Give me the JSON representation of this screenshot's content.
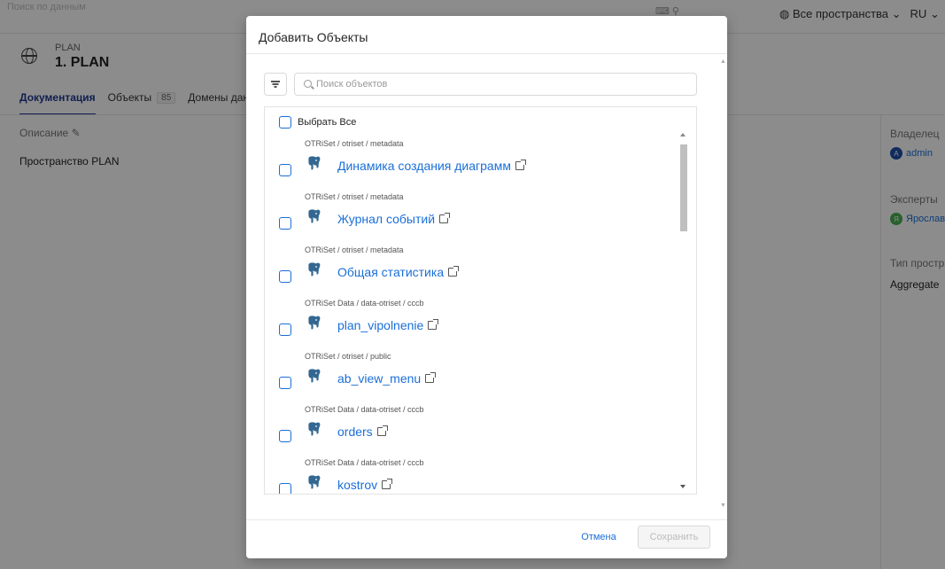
{
  "topbar": {
    "search_placeholder": "Поиск по данным",
    "spaces_label": "Все пространства",
    "lang": "RU"
  },
  "space": {
    "code": "PLAN",
    "title": "1. PLAN"
  },
  "tabs": [
    {
      "label": "Документация"
    },
    {
      "label": "Объекты",
      "count": "85"
    },
    {
      "label": "Домены данных"
    }
  ],
  "description": {
    "label": "Описание",
    "text": "Пространство PLAN"
  },
  "right_panel": {
    "owner_label": "Владелец",
    "owner_value": "admin",
    "owner_avatar": "A",
    "experts_label": "Эксперты",
    "experts_value": "Ярослав",
    "experts_avatar": "Я",
    "type_label": "Тип пространства",
    "type_value": "Aggregate"
  },
  "modal": {
    "title": "Добавить Объекты",
    "search_placeholder": "Поиск объектов",
    "select_all_label": "Выбрать Все",
    "cancel_label": "Отмена",
    "save_label": "Сохранить",
    "items": [
      {
        "path": "OTRiSet  /  otriset  /  metadata",
        "name": "Динамика создания диаграмм"
      },
      {
        "path": "OTRiSet  /  otriset  /  metadata",
        "name": "Журнал событий"
      },
      {
        "path": "OTRiSet  /  otriset  /  metadata",
        "name": "Общая статистика"
      },
      {
        "path": "OTRiSet Data  /  data-otriset  /  cccb",
        "name": "plan_vipolnenie"
      },
      {
        "path": "OTRiSet  /  otriset  /  public",
        "name": "ab_view_menu"
      },
      {
        "path": "OTRiSet Data  /  data-otriset  /  cccb",
        "name": "orders"
      },
      {
        "path": "OTRiSet Data  /  data-otriset  /  cccb",
        "name": "kostrov"
      }
    ]
  },
  "colors": {
    "accent": "#1a6fd8",
    "owner_avatar": "#1f4fa8",
    "expert_avatar": "#4caf50"
  },
  "icons": {
    "db": "postgresql-elephant-icon",
    "external": "external-link-icon",
    "filter": "filter-icon",
    "search": "search-icon"
  }
}
